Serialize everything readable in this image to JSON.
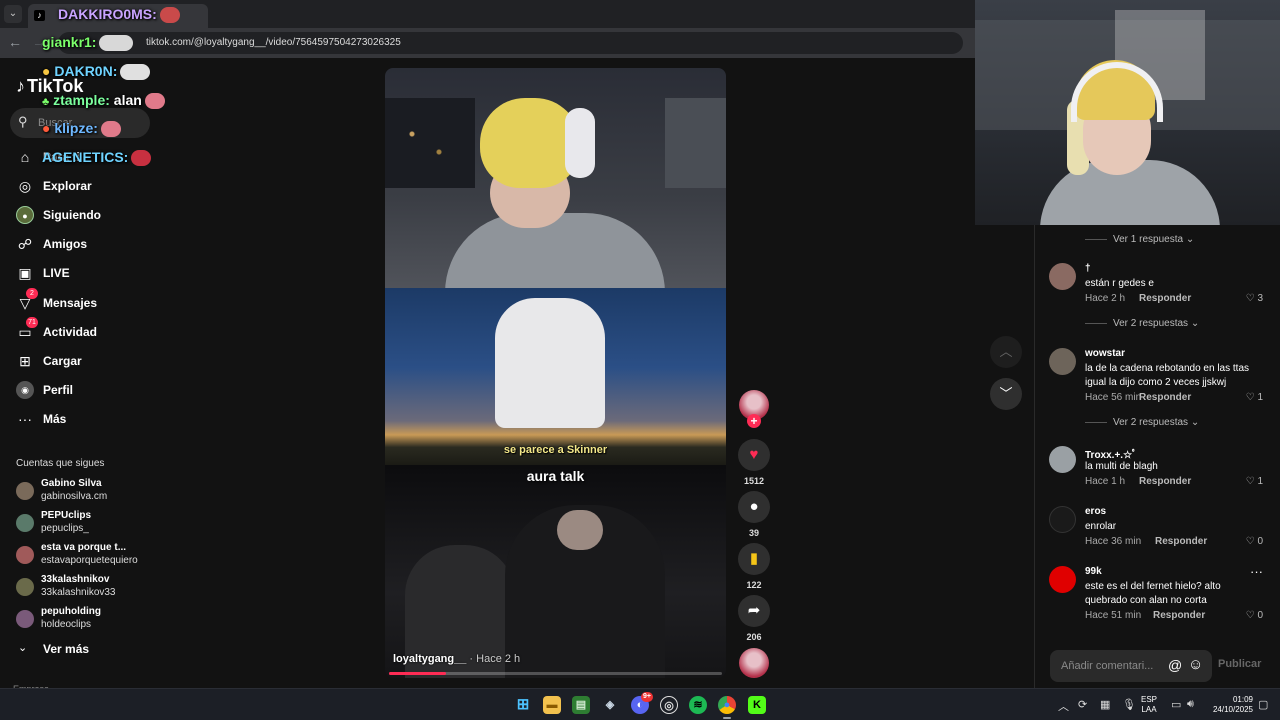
{
  "browser": {
    "tab_title": "",
    "url": "tiktok.com/@loyaltygang__/video/7564597504273026325"
  },
  "chat": [
    {
      "user": "DAKKIRO0MS:",
      "color": "#c9a4ff"
    },
    {
      "user": "giankr1:",
      "color": "#7cff6b"
    },
    {
      "user": "DAKR0N:",
      "color": "#6fd3ff"
    },
    {
      "user": "ztample:",
      "message": "alan",
      "color": "#7cff9e"
    },
    {
      "user": "klipze:",
      "color": "#6fb8ff"
    },
    {
      "user": "AGENETICS:",
      "color": "#6fd3ff"
    }
  ],
  "tiktok": {
    "logo": "TikTok",
    "search_placeholder": "Buscar",
    "nav": [
      {
        "label": "Para ti",
        "icon": "home-icon"
      },
      {
        "label": "Explorar",
        "icon": "compass-icon"
      },
      {
        "label": "Siguiendo",
        "icon": "following-icon"
      },
      {
        "label": "Amigos",
        "icon": "friends-icon"
      },
      {
        "label": "LIVE",
        "icon": "live-icon"
      },
      {
        "label": "Mensajes",
        "icon": "messages-icon",
        "badge": "2"
      },
      {
        "label": "Actividad",
        "icon": "activity-icon",
        "badge": "71"
      },
      {
        "label": "Cargar",
        "icon": "upload-icon"
      },
      {
        "label": "Perfil",
        "icon": "profile-icon"
      },
      {
        "label": "Más",
        "icon": "more-icon"
      }
    ],
    "following_heading": "Cuentas que sigues",
    "following": [
      {
        "name": "Gabino Silva",
        "handle": "gabinosilva.cm"
      },
      {
        "name": "PEPUclips",
        "handle": "pepuclips_"
      },
      {
        "name": "esta va porque t...",
        "handle": "estavaporquetequiero"
      },
      {
        "name": "33kalashnikov",
        "handle": "33kalashnikov33"
      },
      {
        "name": "pepuholding",
        "handle": "holdeoclips"
      }
    ],
    "see_more": "Ver más",
    "company": "Empresa"
  },
  "video": {
    "caption_mid": "se parece a Skinner",
    "caption_title": "aura talk",
    "author": "loyaltygang__",
    "time": " · Hace 2 h",
    "progress": 0.17
  },
  "actions": {
    "likes": "1512",
    "comments": "39",
    "saves": "122",
    "shares": "206"
  },
  "comments": {
    "replies": [
      "Ver 1 respuesta",
      "Ver 2 respuestas",
      "Ver 2 respuestas"
    ],
    "items": [
      {
        "name": "†",
        "text": "están r gedes e",
        "time": "Hace 2 h",
        "reply": "Responder",
        "likes": "3",
        "avatar_color": "#8a6a62"
      },
      {
        "name": "wowstar",
        "text": "la de la cadena rebotando en las ttas igual la dijo como 2 veces jjskwj",
        "time": "Hace 56 min",
        "reply": "Responder",
        "likes": "1",
        "avatar_color": "#6d645a"
      },
      {
        "name": "Troxx.+.☆ﾟ",
        "text": "la multi de blagh",
        "time": "Hace 1 h",
        "reply": "Responder",
        "likes": "1",
        "avatar_color": "#9aa0a4"
      },
      {
        "name": "eros",
        "text": "enrolar",
        "time": "Hace 36 min",
        "reply": "Responder",
        "likes": "0",
        "avatar_color": "#1a1a1a"
      },
      {
        "name": "99k",
        "text": "este es el del fernet hielo? alto quebrado con alan no corta",
        "time": "Hace 51 min",
        "reply": "Responder",
        "likes": "0",
        "avatar_color": "#e00000"
      }
    ],
    "input_placeholder": "Añadir comentari...",
    "publish": "Publicar"
  },
  "taskbar": {
    "lang": "ESP",
    "layout": "LAA",
    "time": "01:09",
    "date": "24/10/2025",
    "discord_badge": "9+"
  },
  "colors": {
    "accent": "#fe2c55",
    "bg": "#121212"
  }
}
